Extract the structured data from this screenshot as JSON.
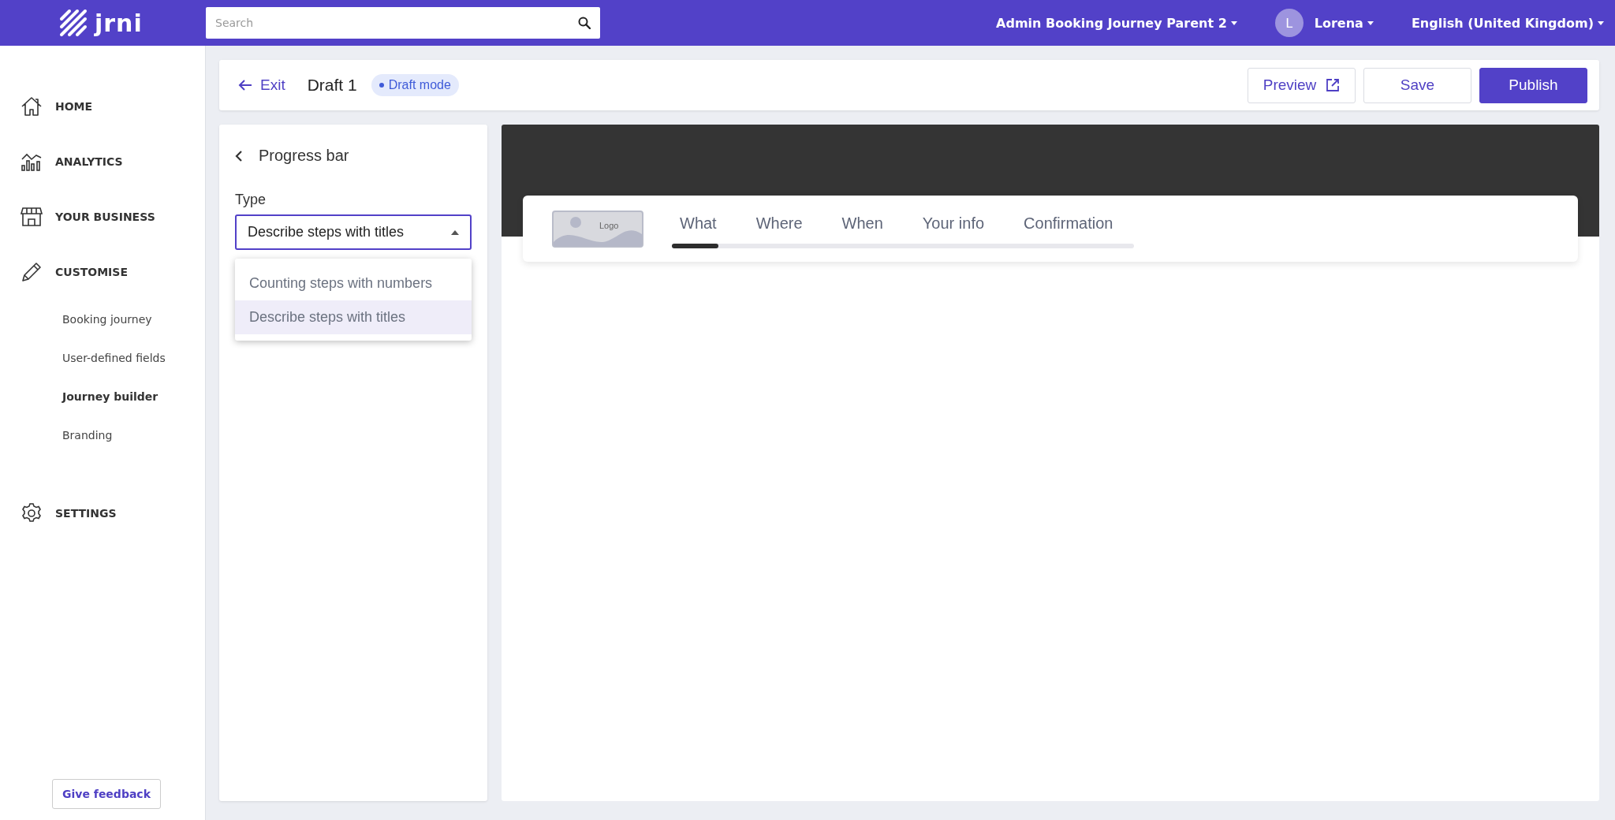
{
  "topbar": {
    "logo": "jrni",
    "search": {
      "placeholder": "Search"
    },
    "account": "Admin Booking Journey Parent 2",
    "user": {
      "initial": "L",
      "name": "Lorena"
    },
    "language": "English (United Kingdom)"
  },
  "sidebar": {
    "items": [
      {
        "label": "HOME"
      },
      {
        "label": "ANALYTICS"
      },
      {
        "label": "YOUR BUSINESS"
      },
      {
        "label": "CUSTOMISE",
        "children": [
          {
            "label": "Booking journey",
            "selected": false
          },
          {
            "label": "User-defined fields",
            "selected": false
          },
          {
            "label": "Journey builder",
            "selected": true
          },
          {
            "label": "Branding",
            "selected": false
          }
        ]
      },
      {
        "label": "SETTINGS"
      }
    ],
    "feedback_button": "Give feedback"
  },
  "header": {
    "exit": "Exit",
    "title": "Draft 1",
    "status": "Draft mode",
    "buttons": [
      {
        "label": "Preview",
        "kind": "external"
      },
      {
        "label": "Save",
        "kind": "secondary"
      },
      {
        "label": "Publish",
        "kind": "primary"
      }
    ]
  },
  "panel": {
    "title": "Progress bar",
    "field_label": "Type",
    "select": {
      "value": "Describe steps with titles",
      "expanded": true
    },
    "options": [
      {
        "label": "Counting steps with numbers",
        "selected": false
      },
      {
        "label": "Describe steps with titles",
        "selected": true
      }
    ]
  },
  "preview": {
    "logo": "Logo",
    "steps": [
      "What",
      "Where",
      "When",
      "Your info",
      "Confirmation"
    ],
    "progress": {
      "level": 0.1
    }
  }
}
